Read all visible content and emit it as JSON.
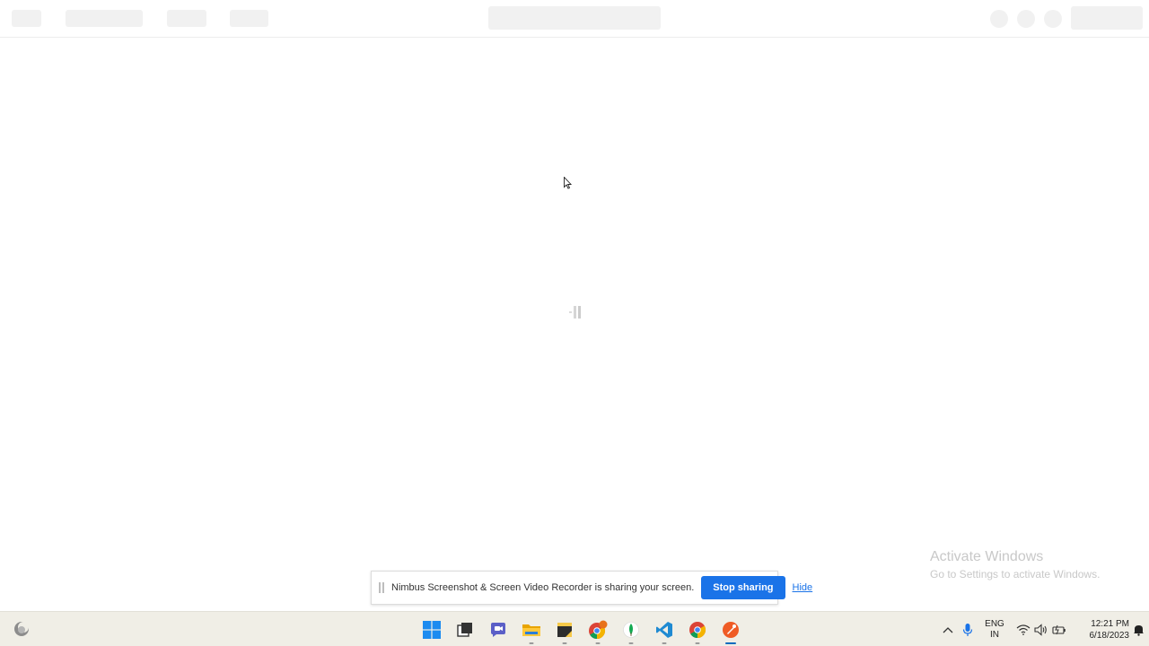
{
  "watermark": {
    "title": "Activate Windows",
    "subtitle": "Go to Settings to activate Windows."
  },
  "share_bar": {
    "message": "Nimbus Screenshot & Screen Video Recorder is sharing your screen.",
    "stop_label": "Stop sharing",
    "hide_label": "Hide"
  },
  "taskbar": {
    "apps": [
      {
        "name": "start-button",
        "icon": "windows-logo-icon"
      },
      {
        "name": "task-view-button",
        "icon": "task-view-icon"
      },
      {
        "name": "chat-button",
        "icon": "teams-chat-icon"
      },
      {
        "name": "file-explorer-button",
        "icon": "folder-icon"
      },
      {
        "name": "sticky-notes-button",
        "icon": "sticky-notes-icon"
      },
      {
        "name": "chrome-profile-button",
        "icon": "chrome-icon"
      },
      {
        "name": "mongodb-compass-button",
        "icon": "mongodb-leaf-icon"
      },
      {
        "name": "vscode-button",
        "icon": "vscode-icon"
      },
      {
        "name": "chrome-button",
        "icon": "chrome-icon"
      },
      {
        "name": "postman-button",
        "icon": "postman-icon"
      }
    ],
    "tray": {
      "lang_line1": "ENG",
      "lang_line2": "IN",
      "time": "12:21 PM",
      "date": "6/18/2023"
    }
  },
  "colors": {
    "accent": "#1a73e8",
    "taskbar_bg": "#f0eee6",
    "skeleton": "#f1f1f1"
  }
}
